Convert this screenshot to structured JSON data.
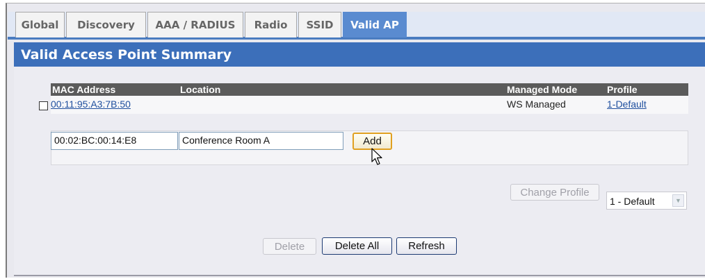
{
  "tabs": [
    {
      "label": "Global"
    },
    {
      "label": "Discovery"
    },
    {
      "label": "AAA / RADIUS"
    },
    {
      "label": "Radio"
    },
    {
      "label": "SSID"
    },
    {
      "label": "Valid AP"
    }
  ],
  "active_tab": "Valid AP",
  "section_title": "Valid Access Point Summary",
  "table": {
    "headers": {
      "mac": "MAC Address",
      "location": "Location",
      "managed_mode": "Managed Mode",
      "profile": "Profile"
    },
    "rows": [
      {
        "mac": "00:11:95:A3:7B:50",
        "location": "",
        "managed_mode": "WS Managed",
        "profile": "1-Default"
      }
    ]
  },
  "add_form": {
    "mac_value": "00:02:BC:00:14:E8",
    "location_value": "Conference Room A",
    "add_label": "Add"
  },
  "change_profile": {
    "button_label": "Change Profile",
    "selected": "1 - Default"
  },
  "actions": {
    "delete": "Delete",
    "delete_all": "Delete All",
    "refresh": "Refresh"
  },
  "colors": {
    "accent": "#3c6fba",
    "active_tab": "#5a8bd0",
    "table_header": "#5b5b5b",
    "link": "#1f4f9e"
  }
}
